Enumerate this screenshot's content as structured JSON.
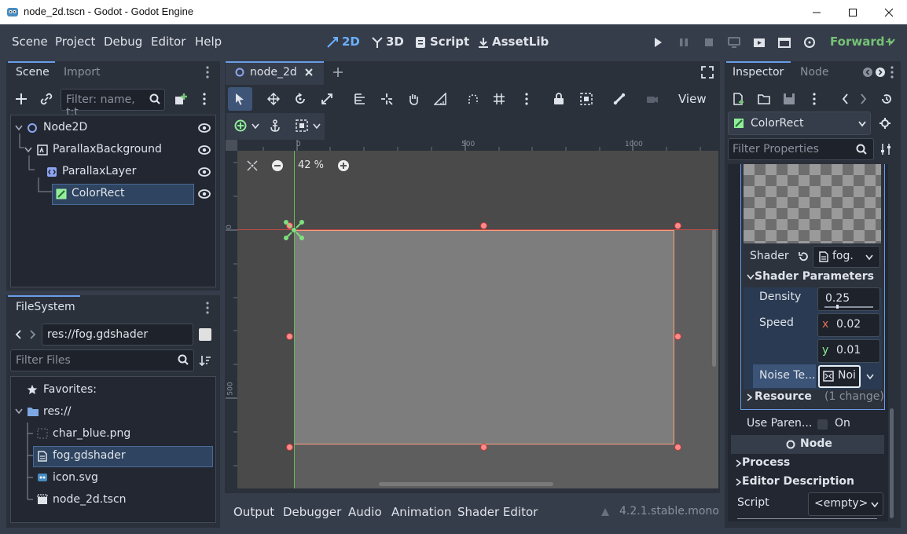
{
  "window": {
    "title": "node_2d.tscn - Godot - Godot Engine"
  },
  "menubar": {
    "menus": [
      "Scene",
      "Project",
      "Debug",
      "Editor",
      "Help"
    ],
    "modes": [
      "2D",
      "3D",
      "Script",
      "AssetLib"
    ],
    "renderer": "Forward+"
  },
  "scene_dock": {
    "tabs": [
      "Scene",
      "Import"
    ],
    "filter_placeholder": "Filter: name, t:t",
    "nodes": [
      "Node2D",
      "ParallaxBackground",
      "ParallaxLayer",
      "ColorRect"
    ]
  },
  "filesystem_dock": {
    "title": "FileSystem",
    "path": "res://fog.gdshader",
    "filter_placeholder": "Filter Files",
    "favorites_label": "Favorites:",
    "root": "res://",
    "files": [
      "char_blue.png",
      "fog.gdshader",
      "icon.svg",
      "node_2d.tscn"
    ]
  },
  "editor": {
    "tab_label": "node_2d",
    "view_label": "View",
    "zoom": "42 %",
    "ruler_h": [
      "0",
      "500",
      "1000"
    ],
    "ruler_v": [
      "0",
      "500"
    ]
  },
  "bottom_panel": {
    "tabs": [
      "Output",
      "Debugger",
      "Audio",
      "Animation",
      "Shader Editor"
    ],
    "version": "4.2.1.stable.mono"
  },
  "inspector": {
    "tabs": [
      "Inspector",
      "Node"
    ],
    "object": "ColorRect",
    "filter_placeholder": "Filter Properties",
    "shader_label": "Shader",
    "shader_value": "fog.",
    "shader_params_label": "Shader Parameters",
    "density_label": "Density",
    "density_value": "0.25",
    "density_fraction": 0.25,
    "speed_label": "Speed",
    "speed_x_label": "x",
    "speed_x": "0.02",
    "speed_y_label": "y",
    "speed_y": "0.01",
    "noise_label": "Noise Te...",
    "noise_value": "Noi",
    "resource_label": "Resource",
    "resource_change": "(1 change)",
    "use_parent_label": "Use Paren...",
    "use_parent_value": "On",
    "node_section": "Node",
    "process_label": "Process",
    "editor_desc_label": "Editor Description",
    "script_label": "Script",
    "script_value": "<empty>"
  },
  "colors": {
    "accent": "#699ce8",
    "selection": "#2e4460",
    "rect_border": "#ff9d7a",
    "handle": "#ff8a8a",
    "pivot": "#7ee07e"
  }
}
